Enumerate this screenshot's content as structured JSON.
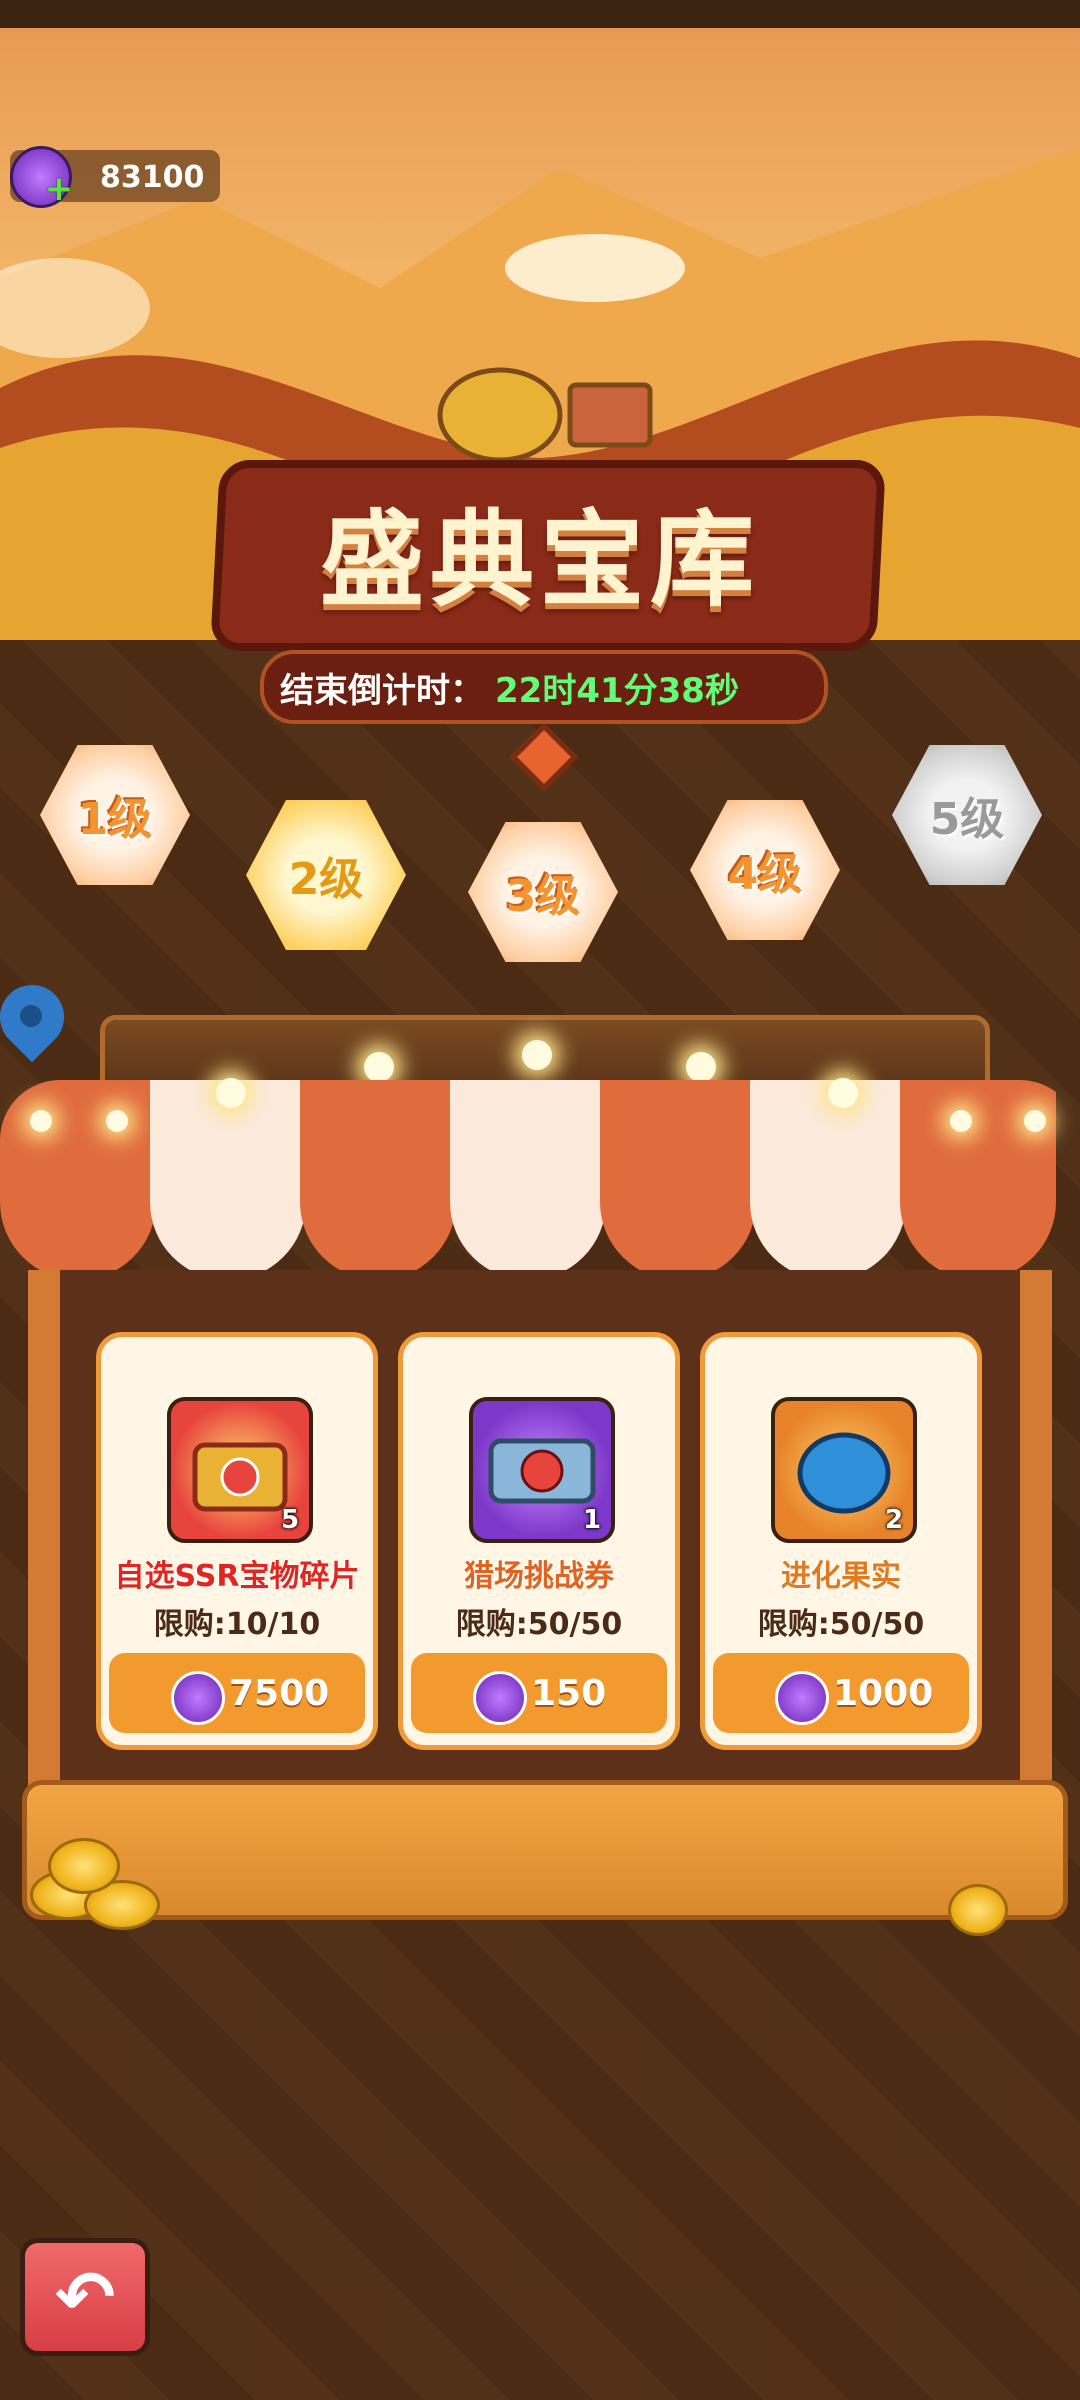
{
  "currency": {
    "value": "83100",
    "icon": "purple-gear-coin-icon"
  },
  "banner": {
    "title": "盛典宝库",
    "timer_label": "结束倒计时：",
    "timer_value": "22时41分38秒"
  },
  "levels": [
    {
      "label": "1级",
      "state": "available"
    },
    {
      "label": "2级",
      "state": "selected"
    },
    {
      "label": "3级",
      "state": "available"
    },
    {
      "label": "4级",
      "state": "available"
    },
    {
      "label": "5级",
      "state": "locked"
    }
  ],
  "shop": {
    "items": [
      {
        "name": "自选SSR宝物碎片",
        "count": "5",
        "limit": "限购:10/10",
        "price": "7500",
        "name_color": "#e0261f",
        "icon": "treasure-chest-icon"
      },
      {
        "name": "猎场挑战券",
        "count": "1",
        "limit": "限购:50/50",
        "price": "150",
        "name_color": "#e0641f",
        "icon": "skull-ticket-icon"
      },
      {
        "name": "进化果实",
        "count": "2",
        "limit": "限购:50/50",
        "price": "1000",
        "name_color": "#e07a1f",
        "icon": "evolution-fruit-icon"
      }
    ]
  },
  "colors": {
    "accent": "#f29a2e",
    "timer": "#5fff78"
  }
}
